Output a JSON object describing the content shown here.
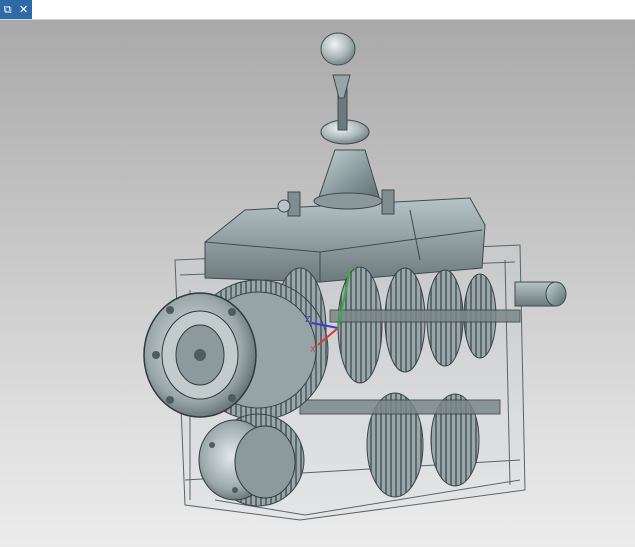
{
  "window": {
    "title": "",
    "restore_icon": "window-restore-icon",
    "close_icon": "close-icon",
    "accent_color": "#2e6aa8"
  },
  "viewport": {
    "background_top": "#a9a9a9",
    "background_bottom": "#ececec",
    "model_name": "",
    "triad": {
      "x_color": "#d23c3c",
      "y_color": "#3cab3c",
      "z_color": "#3c3cd2"
    }
  }
}
